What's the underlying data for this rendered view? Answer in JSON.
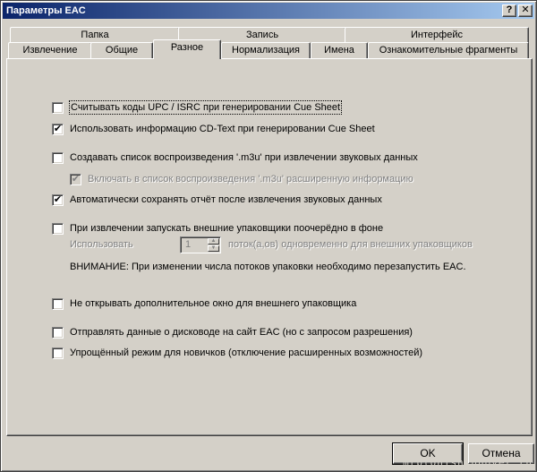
{
  "window": {
    "title": "Параметры EAC",
    "help_glyph": "?",
    "close_glyph": "✕"
  },
  "tabs_row1": [
    "Папка",
    "Запись",
    "Интерфейс"
  ],
  "tabs_row2": [
    "Извлечение",
    "Общие",
    "Разное",
    "Нормализация",
    "Имена",
    "Ознакомительные фрагменты"
  ],
  "active_tab": "Разное",
  "options": [
    {
      "label": "Считывать коды UPC / ISRC при генерировании Cue Sheet",
      "checked": false,
      "enabled": true
    },
    {
      "label": "Использовать информацию CD-Text при генерировании Cue Sheet",
      "checked": true,
      "enabled": true
    },
    {
      "label": "Создавать список воспроизведения '.m3u' при извлечении звуковых данных",
      "checked": false,
      "enabled": true
    },
    {
      "label": "Включать в список воспроизведения '.m3u' расширенную информацию",
      "checked": true,
      "enabled": false
    },
    {
      "label": "Автоматически сохранять отчёт после извлечения звуковых данных",
      "checked": true,
      "enabled": true
    },
    {
      "label": "При извлечении запускать внешние упаковщики поочерёдно в фоне",
      "checked": false,
      "enabled": true
    },
    {
      "label": "Не открывать дополнительное окно для внешнего упаковщика",
      "checked": false,
      "enabled": true
    },
    {
      "label": "Отправлять данные о дисководе на сайт EAC (но с запросом разрешения)",
      "checked": false,
      "enabled": true
    },
    {
      "label": "Упрощённый режим для новичков (отключение расширенных возможностей)",
      "checked": false,
      "enabled": true
    }
  ],
  "threads": {
    "prefix": "Использовать",
    "value": "1",
    "suffix": "поток(а,ов) одновременно для внешних упаковщиков"
  },
  "warning": "ВНИМАНИЕ: При изменении числа потоков упаковки необходимо перезапустить EAC.",
  "buttons": {
    "ok": "OK",
    "cancel": "Отмена"
  },
  "watermark": "mrplohish.nnover.ru"
}
